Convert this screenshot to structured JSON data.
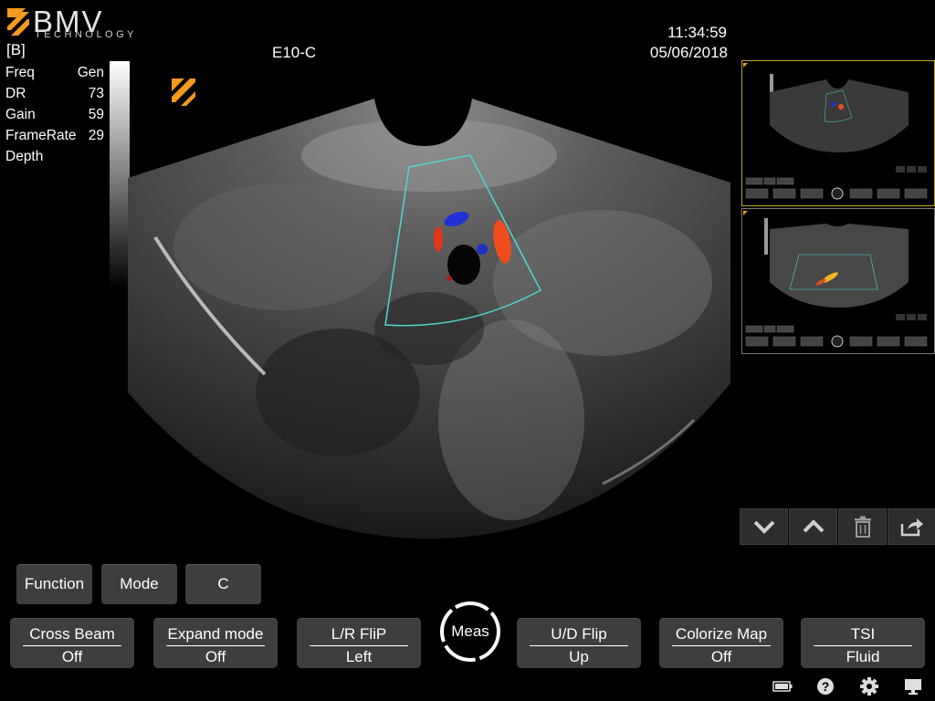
{
  "brand": {
    "name": "BMV",
    "tagline": "TECHNOLOGY"
  },
  "image_mode": "[B]",
  "params": [
    {
      "label": "Freq",
      "value": "Gen"
    },
    {
      "label": "DR",
      "value": "73"
    },
    {
      "label": "Gain",
      "value": "59"
    },
    {
      "label": "FrameRate",
      "value": "29"
    },
    {
      "label": "Depth",
      "value": ""
    }
  ],
  "probe": "E10-C",
  "time": "11:34:59",
  "date": "05/06/2018",
  "top_buttons": {
    "function": "Function",
    "mode": "Mode",
    "c": "C"
  },
  "toggles": [
    {
      "label": "Cross Beam",
      "value": "Off"
    },
    {
      "label": "Expand mode",
      "value": "Off"
    },
    {
      "label": "L/R FliP",
      "value": "Left"
    },
    {
      "label": "U/D Flip",
      "value": "Up"
    },
    {
      "label": "Colorize Map",
      "value": "Off"
    },
    {
      "label": "TSI",
      "value": "Fluid"
    }
  ],
  "meas_label": "Meas",
  "thumbnail_controls": [
    "chevron-down-icon",
    "chevron-up-icon",
    "trash-icon",
    "export-icon"
  ],
  "status_icons": [
    "battery-icon",
    "help-icon",
    "gear-icon",
    "monitor-icon"
  ],
  "colors": {
    "accent": "#f39a1f",
    "roi": "#4fd6d0",
    "button": "#3e3e3e"
  }
}
